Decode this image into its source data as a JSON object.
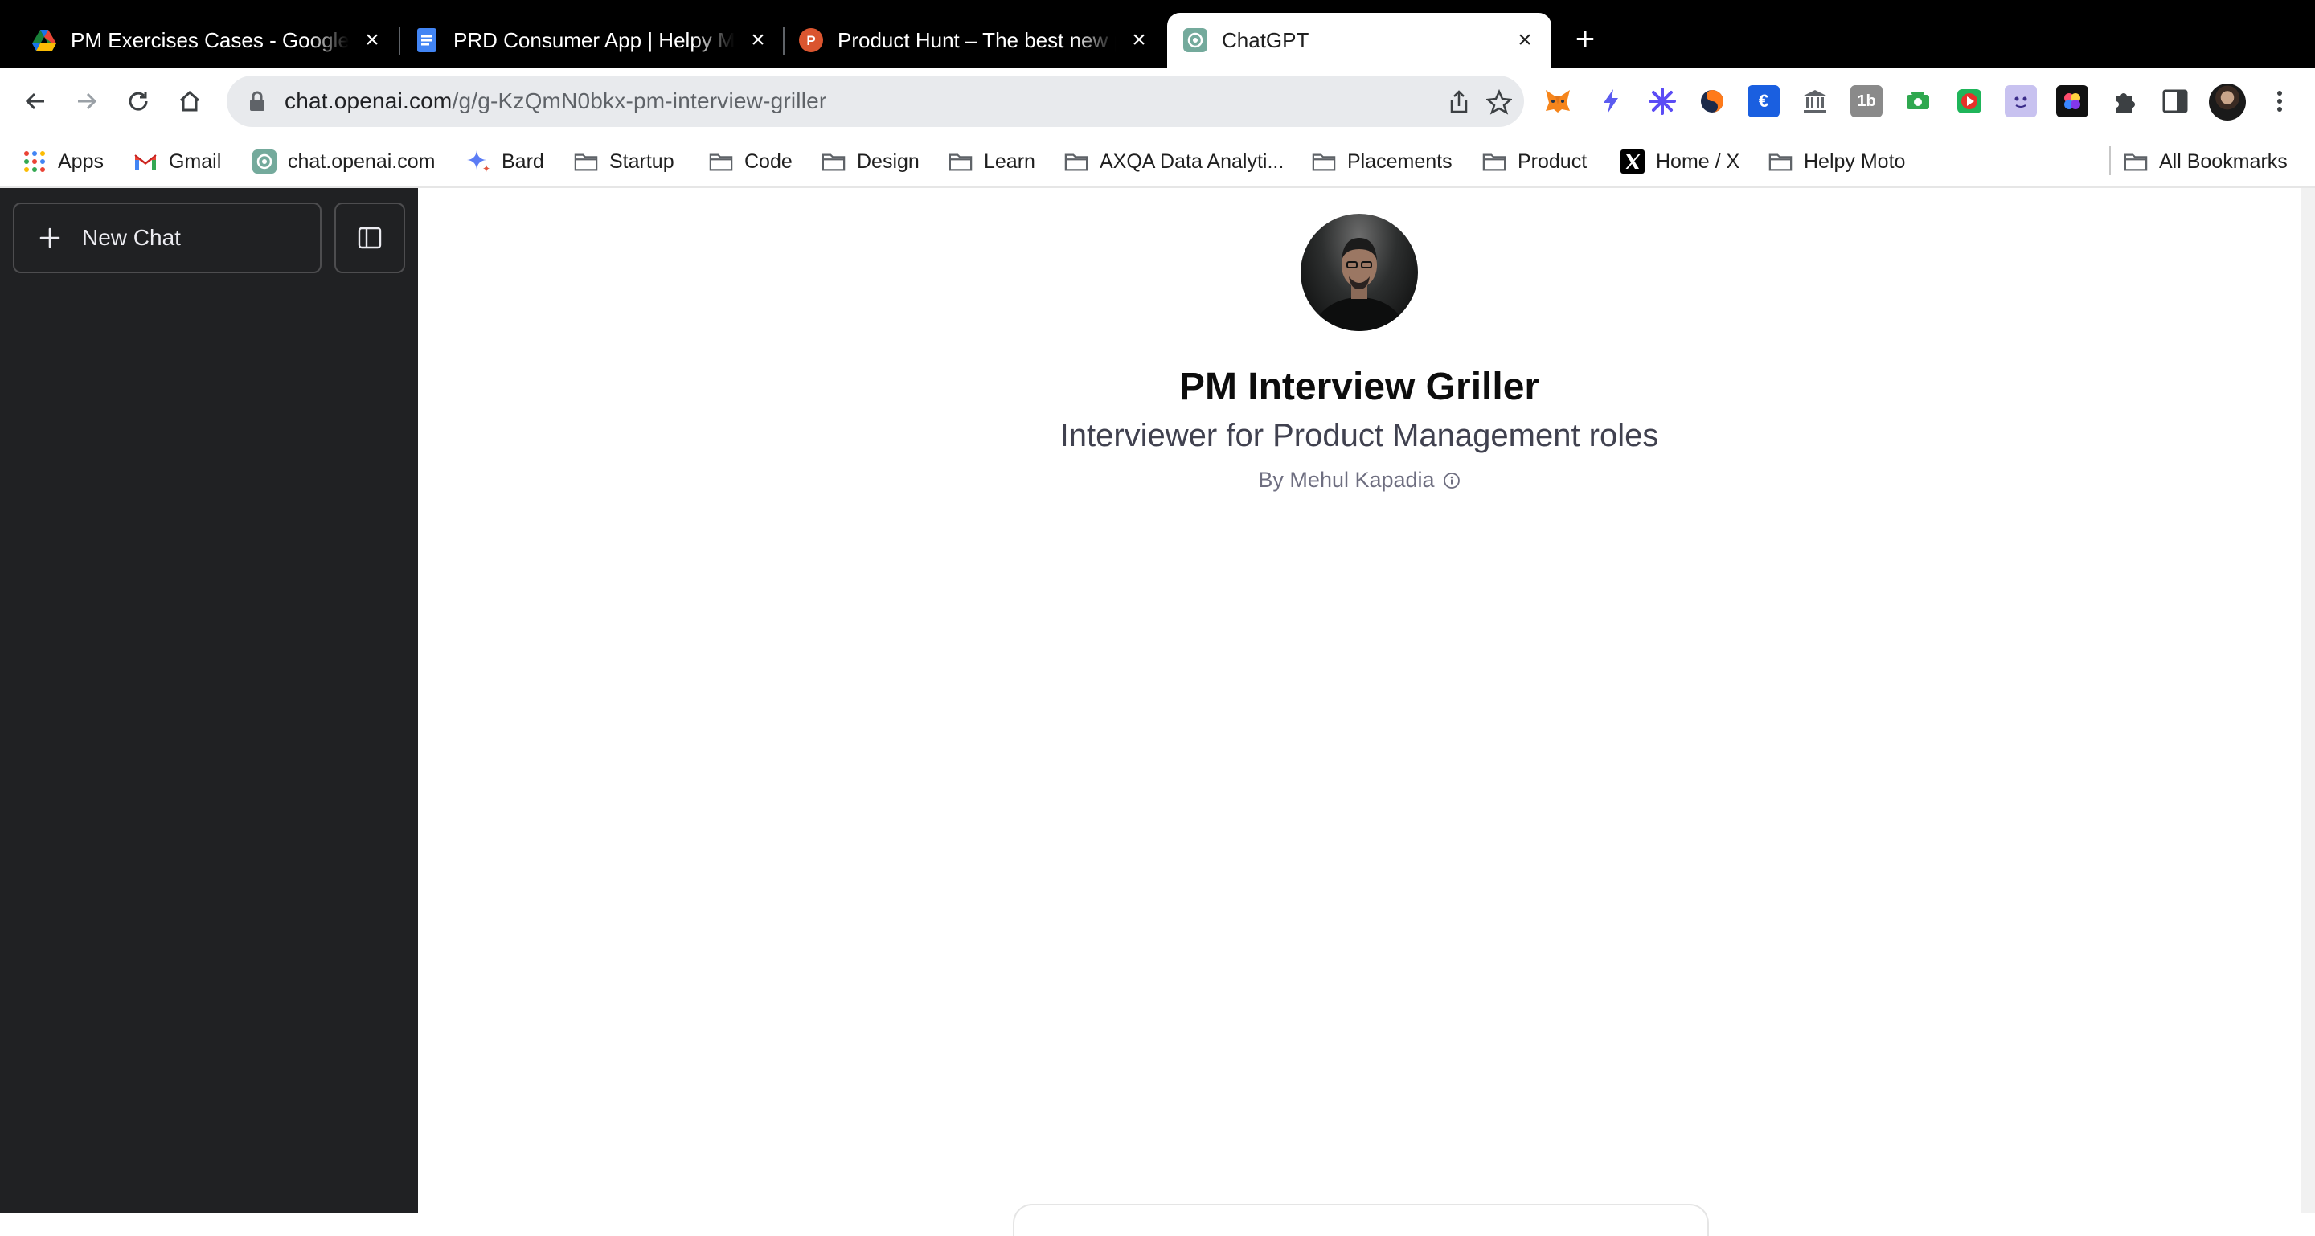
{
  "tabs": [
    {
      "title": "PM Exercises Cases - Google Sheets",
      "favicon": "google-drive-icon",
      "active": false
    },
    {
      "title": "PRD Consumer App | Helpy Moto",
      "favicon": "google-docs-icon",
      "active": false
    },
    {
      "title": "Product Hunt – The best new products",
      "favicon": "product-hunt-icon",
      "active": false
    },
    {
      "title": "ChatGPT",
      "favicon": "chatgpt-icon",
      "active": true
    }
  ],
  "address_bar": {
    "domain": "chat.openai.com",
    "path": "/g/g-KzQmN0bkx-pm-interview-griller"
  },
  "bookmarks": [
    {
      "label": "Apps",
      "icon": "apps-grid-icon"
    },
    {
      "label": "Gmail",
      "icon": "gmail-icon"
    },
    {
      "label": "chat.openai.com",
      "icon": "chatgpt-icon"
    },
    {
      "label": "Bard",
      "icon": "bard-sparkle-icon"
    },
    {
      "label": "Startup",
      "icon": "folder-icon"
    },
    {
      "label": "Code",
      "icon": "folder-icon"
    },
    {
      "label": "Design",
      "icon": "folder-icon"
    },
    {
      "label": "Learn",
      "icon": "folder-icon"
    },
    {
      "label": "AXQA Data Analyti...",
      "icon": "folder-icon"
    },
    {
      "label": "Placements",
      "icon": "folder-icon"
    },
    {
      "label": "Product",
      "icon": "folder-icon"
    },
    {
      "label": "Home / X",
      "icon": "x-logo-icon"
    },
    {
      "label": "Helpy Moto",
      "icon": "folder-icon"
    },
    {
      "label": "All Bookmarks",
      "icon": "folder-icon"
    }
  ],
  "extension_badges": {
    "euro": "€",
    "one_b": "1b"
  },
  "sidebar": {
    "new_chat_label": "New Chat"
  },
  "gpt": {
    "name": "PM Interview Griller",
    "description": "Interviewer for Product Management roles",
    "author": "By Mehul Kapadia"
  },
  "colors": {
    "sidebar_bg": "#202123",
    "tabstrip_bg": "#000000",
    "omnibox_bg": "#e8eaed"
  }
}
